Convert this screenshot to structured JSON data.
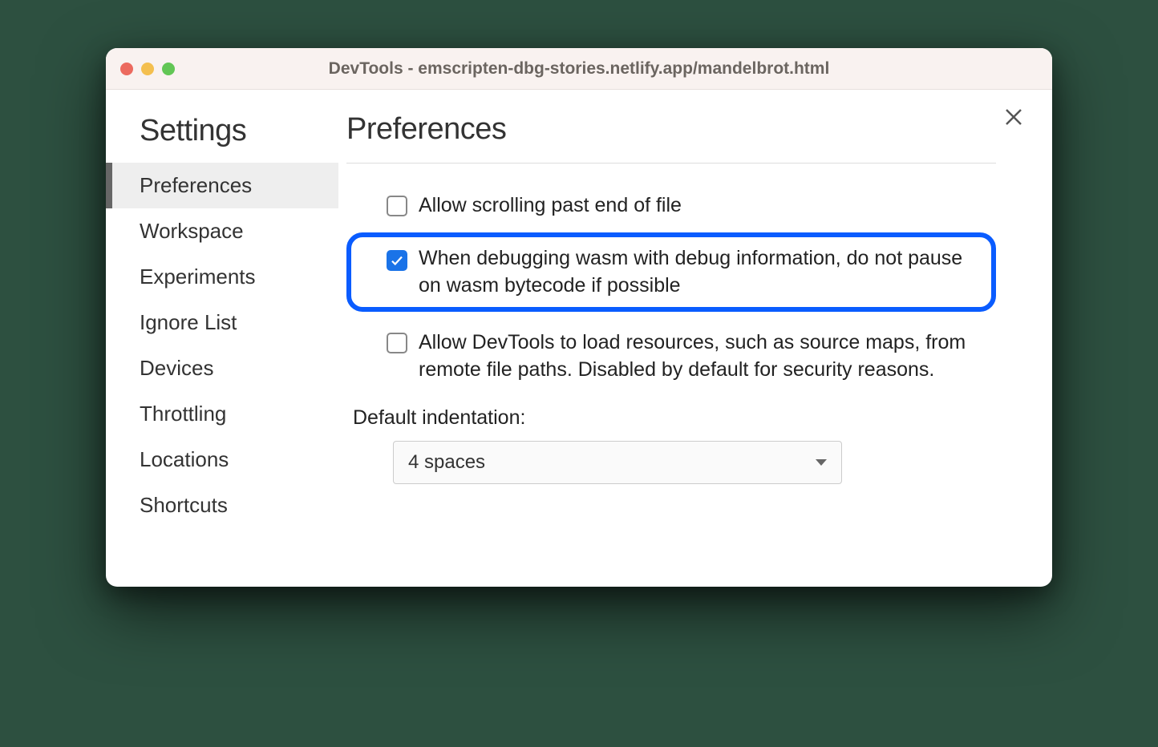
{
  "window": {
    "title": "DevTools - emscripten-dbg-stories.netlify.app/mandelbrot.html"
  },
  "sidebar": {
    "title": "Settings",
    "items": [
      {
        "label": "Preferences",
        "active": true
      },
      {
        "label": "Workspace",
        "active": false
      },
      {
        "label": "Experiments",
        "active": false
      },
      {
        "label": "Ignore List",
        "active": false
      },
      {
        "label": "Devices",
        "active": false
      },
      {
        "label": "Throttling",
        "active": false
      },
      {
        "label": "Locations",
        "active": false
      },
      {
        "label": "Shortcuts",
        "active": false
      }
    ]
  },
  "main": {
    "title": "Preferences",
    "options": [
      {
        "label": "Allow scrolling past end of file",
        "checked": false,
        "highlighted": false
      },
      {
        "label": "When debugging wasm with debug information, do not pause on wasm bytecode if possible",
        "checked": true,
        "highlighted": true
      },
      {
        "label": "Allow DevTools to load resources, such as source maps, from remote file paths. Disabled by default for security reasons.",
        "checked": false,
        "highlighted": false
      }
    ],
    "indentation": {
      "label": "Default indentation:",
      "value": "4 spaces"
    }
  }
}
